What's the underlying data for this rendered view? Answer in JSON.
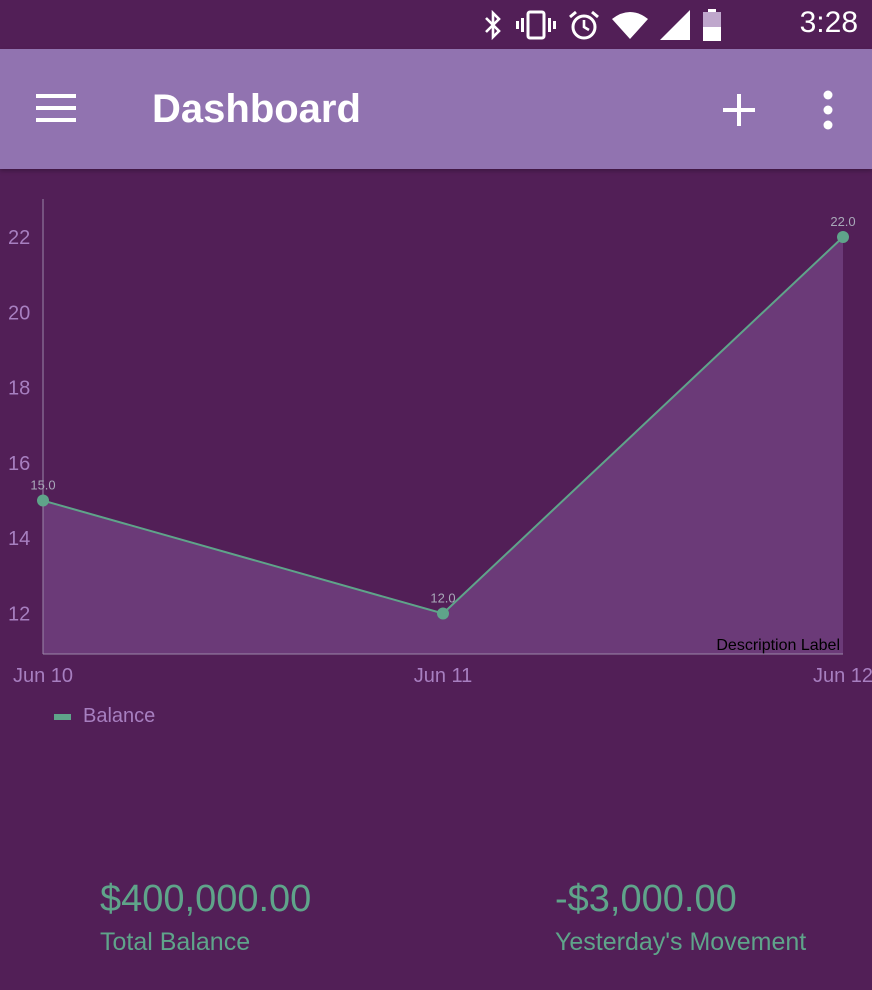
{
  "status_bar": {
    "time": "3:28",
    "icons": [
      "bluetooth-icon",
      "vibrate-icon",
      "alarm-icon",
      "wifi-icon",
      "signal-icon",
      "battery-icon"
    ]
  },
  "app_bar": {
    "title": "Dashboard",
    "background": "#9173b0",
    "menu_icon": "hamburger-menu-icon",
    "add_icon": "plus-icon",
    "more_icon": "more-vertical-icon"
  },
  "chart_data": {
    "type": "area",
    "categories": [
      "Jun 10",
      "Jun 11",
      "Jun 12"
    ],
    "series": [
      {
        "name": "Balance",
        "values": [
          15.0,
          12.0,
          22.0
        ],
        "value_labels": [
          "15.0",
          "12.0",
          "22.0"
        ],
        "color": "#5fa48a"
      }
    ],
    "yticks": [
      "12",
      "14",
      "16",
      "18",
      "20",
      "22"
    ],
    "ylim": [
      11,
      23
    ],
    "grid": false,
    "legend_position": "bottom-left",
    "description": "Description Label"
  },
  "stats": {
    "total_balance": {
      "value": "$400,000.00",
      "label": "Total Balance"
    },
    "yesterday_movement": {
      "value": "-$3,000.00",
      "label": "Yesterday's Movement"
    }
  },
  "colors": {
    "background": "#521f57",
    "accent": "#5fa48a",
    "fill": "#6b3a78",
    "axis_text": "#a77fc0"
  }
}
